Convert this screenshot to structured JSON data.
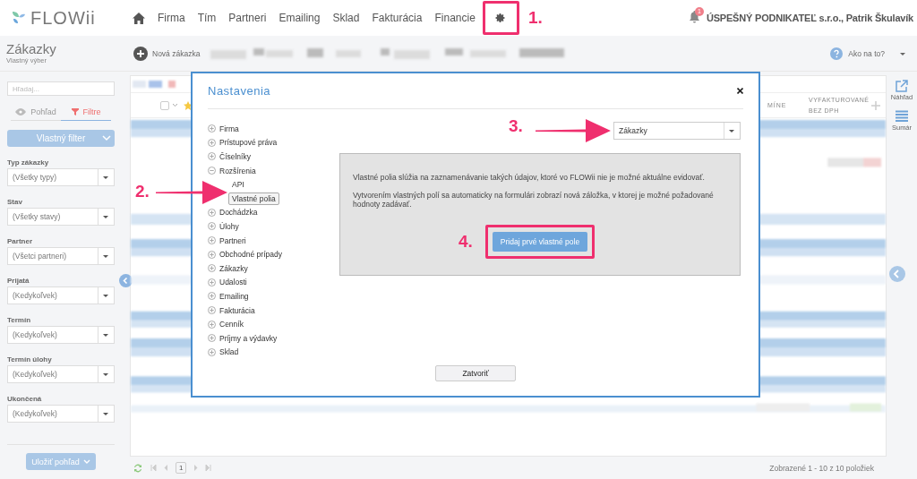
{
  "app": {
    "logo": "FLOWii"
  },
  "nav": [
    {
      "label": "Firma"
    },
    {
      "label": "Tím"
    },
    {
      "label": "Partneri"
    },
    {
      "label": "Emailing"
    },
    {
      "label": "Sklad"
    },
    {
      "label": "Fakturácia"
    },
    {
      "label": "Financie"
    }
  ],
  "account": {
    "notifications": "1",
    "name": "ÚSPEŠNÝ PODNIKATEĽ s.r.o., Patrik Škulavík"
  },
  "page": {
    "title": "Zákazky",
    "subtitle": "Vlastný výber",
    "new_button": "Nová zákazka",
    "help": "Ako na to?"
  },
  "sidebar": {
    "search_placeholder": "Hľadaj...",
    "tabs": [
      {
        "label": "Pohľad",
        "selected": false
      },
      {
        "label": "Filtre",
        "selected": true
      }
    ],
    "filter_button": "Vlastný filter",
    "filters": [
      {
        "label": "Typ zákazky",
        "value": "(Všetky typy)"
      },
      {
        "label": "Stav",
        "value": "(Všetky stavy)"
      },
      {
        "label": "Partner",
        "value": "(Všetci partneri)"
      },
      {
        "label": "Prijatá",
        "value": "(Kedykoľvek)"
      },
      {
        "label": "Termín",
        "value": "(Kedykoľvek)"
      },
      {
        "label": "Termín úlohy",
        "value": "(Kedykoľvek)"
      },
      {
        "label": "Ukončená",
        "value": "(Kedykoľvek)"
      }
    ],
    "save_button": "Uložiť pohľad"
  },
  "table": {
    "header_checkbox": {
      "checked": false
    },
    "columns": [
      "MÍNE",
      "VYFAKTUROVANÉ BEZ DPH"
    ],
    "page": "1",
    "status": "Zobrazené 1 - 10 z 10 položiek"
  },
  "right_rail": [
    {
      "label": "Náhľad",
      "kind": "preview"
    },
    {
      "label": "Sumár",
      "kind": "summary"
    }
  ],
  "dialog": {
    "title": "Nastavenia",
    "tree": [
      {
        "label": "Firma",
        "expanded": false
      },
      {
        "label": "Prístupové práva",
        "expanded": false
      },
      {
        "label": "Číselníky",
        "expanded": false
      },
      {
        "label": "Rozšírenia",
        "expanded": true,
        "children": [
          {
            "label": "API",
            "selected": false
          },
          {
            "label": "Vlastné polia",
            "selected": true
          }
        ]
      },
      {
        "label": "Dochádzka",
        "expanded": false
      },
      {
        "label": "Úlohy",
        "expanded": false
      },
      {
        "label": "Partneri",
        "expanded": false
      },
      {
        "label": "Obchodné prípady",
        "expanded": false
      },
      {
        "label": "Zákazky",
        "expanded": false
      },
      {
        "label": "Udalosti",
        "expanded": false
      },
      {
        "label": "Emailing",
        "expanded": false
      },
      {
        "label": "Fakturácia",
        "expanded": false
      },
      {
        "label": "Cenník",
        "expanded": false
      },
      {
        "label": "Príjmy a výdavky",
        "expanded": false
      },
      {
        "label": "Sklad",
        "expanded": false
      }
    ],
    "module_select": "Zákazky",
    "paragraphs": [
      "Vlastné polia slúžia na zaznamenávanie takých údajov, ktoré vo FLOWii nie je možné aktuálne evidovať.",
      "Vytvorením vlastných polí sa automaticky na formulári zobrazí nová záložka, v ktorej je možné požadované hodnoty zadávať."
    ],
    "add_button": "Pridaj prvé vlastné pole",
    "close_button": "Zatvoriť"
  },
  "annotations": [
    {
      "label": "1.",
      "kind": "frame"
    },
    {
      "label": "2.",
      "kind": "arrow"
    },
    {
      "label": "3.",
      "kind": "arrow"
    },
    {
      "label": "4.",
      "kind": "frame"
    }
  ]
}
